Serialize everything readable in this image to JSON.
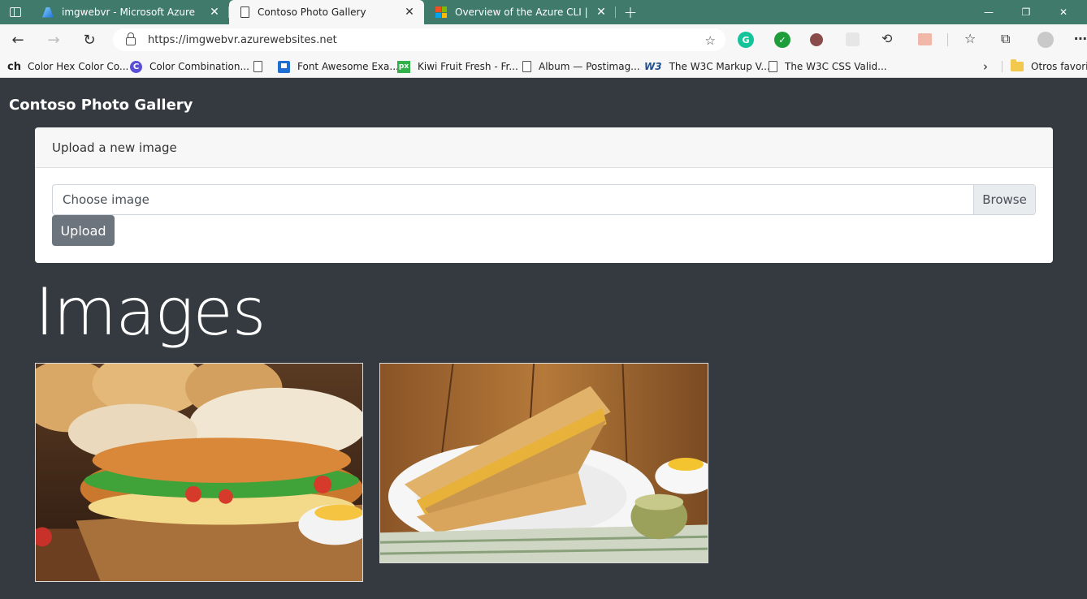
{
  "browser": {
    "tabs": [
      {
        "title": "imgwebvr - Microsoft Azure",
        "icon": "azure-icon",
        "active": false
      },
      {
        "title": "Contoso Photo Gallery",
        "icon": "page-icon",
        "active": true
      },
      {
        "title": "Overview of the Azure CLI | Micr",
        "icon": "microsoft-icon",
        "active": false
      }
    ],
    "new_tab_symbol": "+",
    "url": "https://imgwebvr.azurewebsites.net",
    "bookmarks": [
      {
        "label": "Color Hex Color Co...",
        "prefix": "ch"
      },
      {
        "label": "Color Combination...",
        "icon": "c-circle-icon",
        "icon_text": "C"
      },
      {
        "label": "",
        "icon": "page-icon"
      },
      {
        "label": "Font Awesome Exa...",
        "icon": "flag-icon"
      },
      {
        "label": "Kiwi Fruit Fresh - Fr...",
        "icon": "px-icon",
        "icon_text": "px"
      },
      {
        "label": "Album — Postimag...",
        "icon": "page-icon"
      },
      {
        "label": "The W3C Markup V...",
        "icon": "w3c-icon",
        "icon_text": "W3"
      },
      {
        "label": "The W3C CSS Valid...",
        "icon": "page-icon"
      }
    ],
    "other_favorites": "Otros favorito"
  },
  "page": {
    "brand": "Contoso Photo Gallery",
    "upload_card": {
      "header": "Upload a new image",
      "file_placeholder": "Choose image",
      "browse_label": "Browse",
      "upload_label": "Upload"
    },
    "images_heading": "Images",
    "images": [
      {
        "name": "sandwich-baguette-photo",
        "alt": "Baguette sandwich on cutting board"
      },
      {
        "name": "grilled-sandwich-photo",
        "alt": "Grilled cheese sandwich on plate"
      }
    ]
  },
  "colors": {
    "page_bg": "#343a40",
    "tabstrip": "#3f7a6a",
    "upload_button": "#6c757d"
  }
}
